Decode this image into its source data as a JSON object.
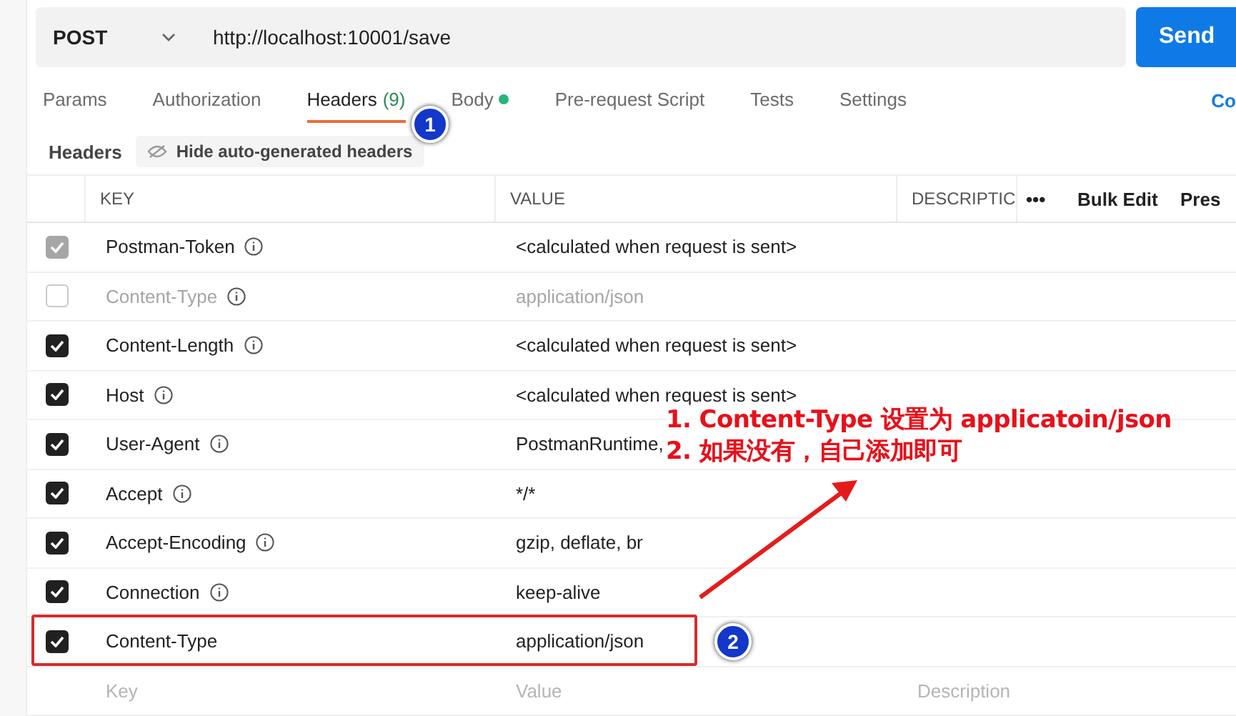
{
  "request": {
    "method": "POST",
    "url": "http://localhost:10001/save",
    "send": "Send"
  },
  "tabs": [
    {
      "label": "Params",
      "selected": false
    },
    {
      "label": "Authorization",
      "selected": false
    },
    {
      "label": "Headers",
      "count": "(9)",
      "selected": true
    },
    {
      "label": "Body",
      "has_content": true,
      "selected": false
    },
    {
      "label": "Pre-request Script",
      "selected": false
    },
    {
      "label": "Tests",
      "selected": false
    },
    {
      "label": "Settings",
      "selected": false
    }
  ],
  "tabs_right_link": "Co",
  "subbar": {
    "title": "Headers",
    "toggle": "Hide auto-generated headers"
  },
  "table": {
    "columns": [
      "KEY",
      "VALUE",
      "DESCRIPTIC"
    ],
    "actions": [
      "•••",
      "Bulk Edit",
      "Pres"
    ],
    "rows": [
      {
        "key": "Postman-Token",
        "value": "<calculated when request is sent>",
        "checked": true,
        "disabled": true,
        "auto_generated": true
      },
      {
        "key": "Content-Type",
        "value": "application/json",
        "checked": false,
        "disabled": false,
        "auto_generated": true
      },
      {
        "key": "Content-Length",
        "value": "<calculated when request is sent>",
        "checked": true,
        "disabled": false,
        "auto_generated": true
      },
      {
        "key": "Host",
        "value": "<calculated when request is sent>",
        "checked": true,
        "disabled": false,
        "auto_generated": true
      },
      {
        "key": "User-Agent",
        "value": "PostmanRuntime,",
        "checked": true,
        "disabled": false,
        "auto_generated": true
      },
      {
        "key": "Accept",
        "value": "*/*",
        "checked": true,
        "disabled": false,
        "auto_generated": true
      },
      {
        "key": "Accept-Encoding",
        "value": "gzip, deflate, br",
        "checked": true,
        "disabled": false,
        "auto_generated": true
      },
      {
        "key": "Connection",
        "value": "keep-alive",
        "checked": true,
        "disabled": false,
        "auto_generated": true
      },
      {
        "key": "Content-Type",
        "value": "application/json",
        "checked": true,
        "disabled": false,
        "auto_generated": false
      }
    ],
    "new_row": {
      "key": "Key",
      "value": "Value",
      "description": "Description"
    }
  },
  "annotation": {
    "lines": [
      "1. Content-Type 设置为 applicatoin/json",
      "2. 如果没有，自己添加即可"
    ],
    "markers": [
      "1",
      "2"
    ]
  }
}
